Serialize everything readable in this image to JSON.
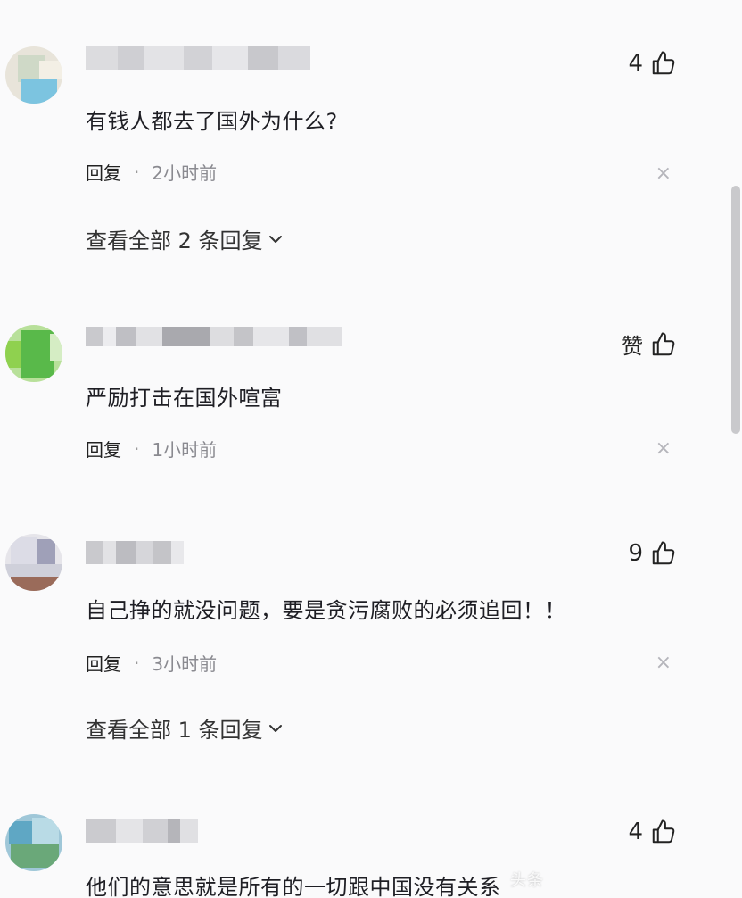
{
  "comments": [
    {
      "like_label": "4",
      "text": "有钱人都去了国外为什么?",
      "reply_label": "回复",
      "separator": "·",
      "time": "2小时前",
      "close": "×",
      "view_replies": "查看全部 2 条回复"
    },
    {
      "like_label": "赞",
      "text": "严励打击在国外喧富",
      "reply_label": "回复",
      "separator": "·",
      "time": "1小时前",
      "close": "×"
    },
    {
      "like_label": "9",
      "text": "自己挣的就没问题，要是贪污腐败的必须追回！！",
      "reply_label": "回复",
      "separator": "·",
      "time": "3小时前",
      "close": "×",
      "view_replies": "查看全部 1 条回复"
    },
    {
      "like_label": "4",
      "text": "他们的意思就是所有的一切跟中国没有关系"
    }
  ],
  "watermark": "头条",
  "icons": {
    "like": "thumbs-up-icon",
    "chevron": "chevron-down-icon",
    "close": "close-icon"
  },
  "colors": {
    "background": "#fafafb",
    "text": "#1e1e24",
    "meta": "#8a8a90",
    "scrollbar": "#c9c9cc"
  }
}
